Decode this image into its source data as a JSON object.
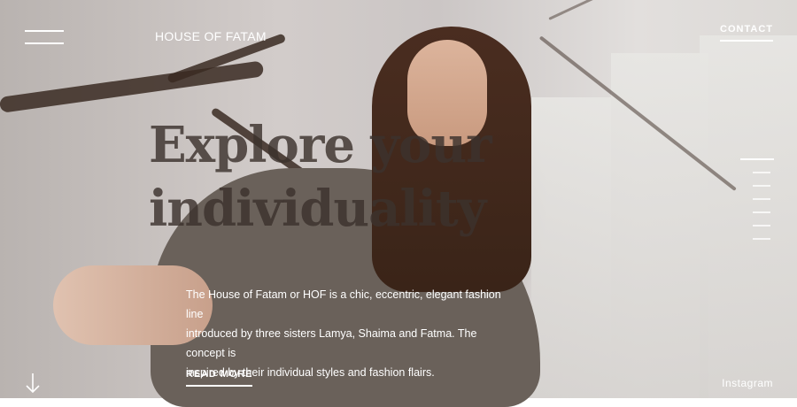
{
  "header": {
    "brand": "HOUSE OF FATAM",
    "contact_label": "CONTACT"
  },
  "hero": {
    "headline_line1": "Explore your",
    "headline_line2": "individuality",
    "intro_line1": "The House of Fatam or HOF is a chic, eccentric, elegant fashion line",
    "intro_line2": "introduced by three sisters Lamya, Shaima and Fatma. The concept is",
    "intro_line3": "inspired by their individual styles and fashion flairs.",
    "read_more_label": "READ MORE"
  },
  "footer": {
    "instagram_label": "Instagram"
  },
  "pager": {
    "count": 7,
    "active_index": 0
  },
  "icons": {
    "menu": "hamburger-menu-icon",
    "scroll": "arrow-down-icon"
  },
  "colors": {
    "text": "#ffffff",
    "headline": "#3c322d"
  }
}
